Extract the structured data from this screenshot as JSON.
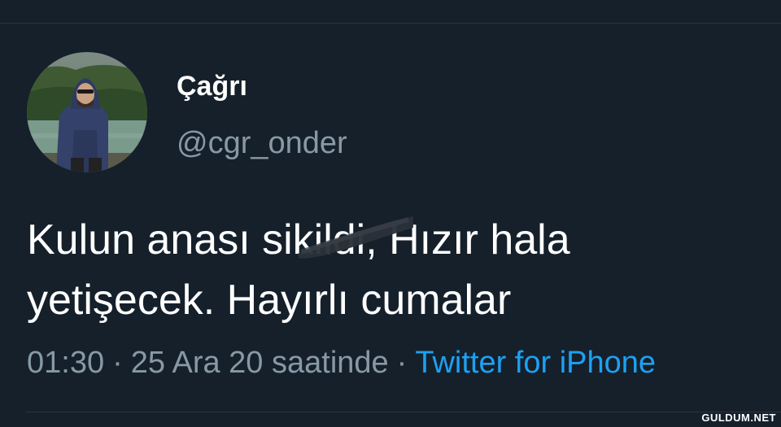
{
  "user": {
    "display_name": "Çağrı",
    "handle": "@cgr_onder"
  },
  "tweet": {
    "line1": "Kulun anası sikildi, Hızır hala",
    "line2": "yetişecek. Hayırlı cumalar"
  },
  "meta": {
    "time": "01:30",
    "separator": "·",
    "date": "25 Ara 20 saatinde",
    "source": "Twitter for iPhone"
  },
  "watermark": "GULDUM.NET",
  "colors": {
    "background": "#15202b",
    "primary_text": "#ffffff",
    "secondary_text": "#8899a6",
    "link": "#1da1f2"
  }
}
